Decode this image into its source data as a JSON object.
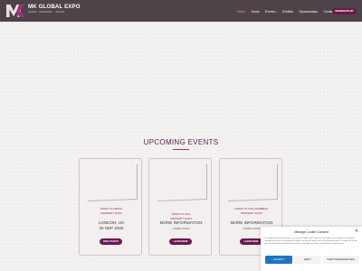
{
  "brand": {
    "name": "MK GLOBAL EXPO",
    "tagline": "LEARN · NETWORK · INVEST",
    "logo_text": "MK"
  },
  "nav": {
    "items": [
      {
        "label": "Home",
        "active": true,
        "has_dropdown": false
      },
      {
        "label": "About",
        "active": false,
        "has_dropdown": false
      },
      {
        "label": "Events",
        "active": false,
        "has_dropdown": true
      },
      {
        "label": "Exhibits",
        "active": false,
        "has_dropdown": false
      },
      {
        "label": "Sponsorships",
        "active": false,
        "has_dropdown": false
      },
      {
        "label": "Contact",
        "active": false,
        "has_dropdown": false
      }
    ],
    "cta_label": "MEMBERSHIP",
    "caret": "▾"
  },
  "section": {
    "title": "UPCOMING EVENTS"
  },
  "events": [
    {
      "name_line1": "INVEST IN AFRICA",
      "name_line2": "PROPERTY EXPO",
      "detail_line1": "LONDON, UK",
      "detail_line2": "25 SEP 2025",
      "button_label": "FREE TICKETS"
    },
    {
      "name_line1": "INVEST IN ASIA",
      "name_line2": "PROPERTY EXPO",
      "detail_line1": "MORE INFORMATION",
      "detail_line2": "COMING SOON",
      "button_label": "LEARN MORE"
    },
    {
      "name_line1": "INVEST IN THE CARIBBEAN",
      "name_line2": "PROPERTY EXPO",
      "detail_line1": "MORE INFORMATION",
      "detail_line2": "COMING SOON",
      "button_label": "LEARN MORE"
    }
  ],
  "consent": {
    "title": "Manage Cookie Consent",
    "body": "To provide the best experiences, we use technologies like cookies to store and/or access device information. Consenting to these technologies will allow us to process data such as browsing behaviour or unique IDs on this site. Not consenting or withdrawing consent, may adversely affect certain features and functions.",
    "accept_label": "ACCEPT",
    "deny_label": "DENY",
    "preferences_label": "VIEW PREFERENCES",
    "close_glyph": "✕"
  },
  "colors": {
    "header_bg": "#4e4348",
    "brand_accent": "#6b1850",
    "title_color": "#5c2148",
    "link_active": "#ff8ab5",
    "accept_blue": "#1e73be"
  }
}
